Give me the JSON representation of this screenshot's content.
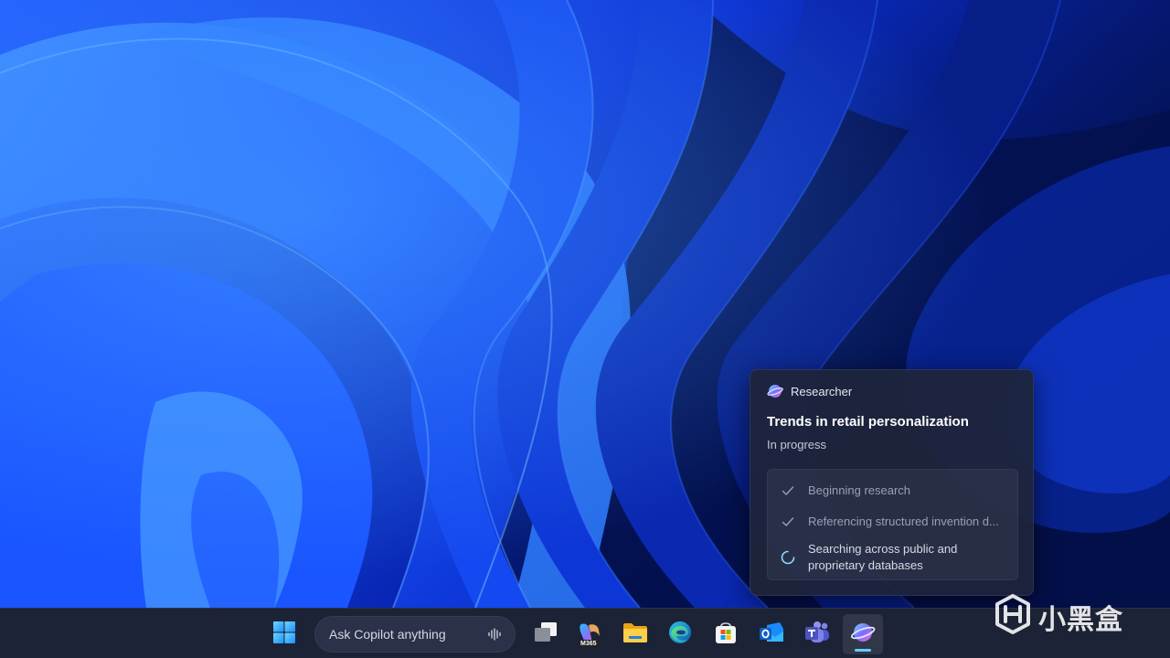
{
  "desktop": {
    "wallpaper": "windows-11-bloom-blue"
  },
  "researcher_card": {
    "app_name": "Researcher",
    "app_icon": "researcher-icon",
    "title": "Trends in retail personalization",
    "status": "In progress",
    "steps": [
      {
        "label": "Beginning research",
        "state": "done",
        "icon": "check-icon"
      },
      {
        "label": "Referencing structured invention d...",
        "state": "done",
        "icon": "check-icon"
      },
      {
        "label": "Searching across public and proprietary databases",
        "state": "active",
        "icon": "spinner-icon"
      }
    ]
  },
  "taskbar": {
    "search": {
      "placeholder": "Ask Copilot anything",
      "icon": "voice-waveform-icon"
    },
    "apps": [
      {
        "name": "Start",
        "icon": "windows-start-icon",
        "active": false
      },
      {
        "name": "Task View",
        "icon": "task-view-icon",
        "active": false
      },
      {
        "name": "Microsoft 365 Copilot",
        "icon": "m365-copilot-icon",
        "badge": "M365",
        "active": false
      },
      {
        "name": "File Explorer",
        "icon": "folder-icon",
        "active": false
      },
      {
        "name": "Microsoft Edge",
        "icon": "edge-icon",
        "active": false
      },
      {
        "name": "Microsoft Store",
        "icon": "store-icon",
        "active": false
      },
      {
        "name": "Outlook",
        "icon": "outlook-icon",
        "active": false
      },
      {
        "name": "Teams",
        "icon": "teams-icon",
        "active": false
      },
      {
        "name": "Researcher",
        "icon": "researcher-icon",
        "active": true
      }
    ]
  },
  "watermark": {
    "text": "小黑盒",
    "icon": "heybox-logo-icon"
  },
  "colors": {
    "accent": "#60cdff",
    "card_bg": "#1e243a",
    "taskbar_bg": "#1d2336",
    "wallpaper_primary": "#1a4cff"
  }
}
